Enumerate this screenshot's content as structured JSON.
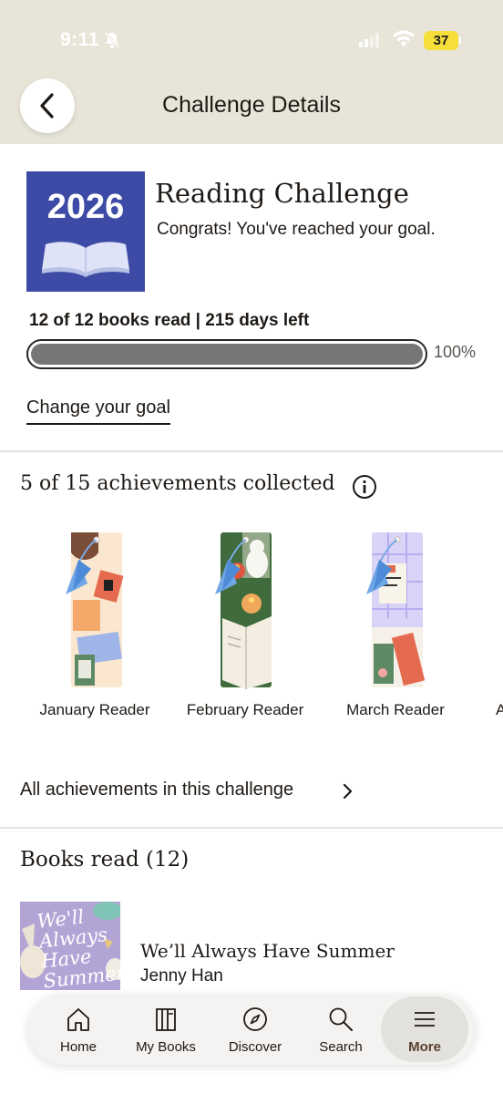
{
  "status_bar": {
    "time": "9:11",
    "battery": "37"
  },
  "header": {
    "title": "Challenge Details"
  },
  "challenge": {
    "badge_year": "2026",
    "title": "Reading Challenge",
    "message": "Congrats! You've reached your goal.",
    "progress_text": "12 of 12 books read | 215 days left",
    "progress_percent_label": "100%",
    "progress_fraction": 1.0,
    "change_goal_label": "Change your goal"
  },
  "achievements": {
    "title": "5 of 15 achievements collected",
    "items": [
      {
        "label": "January Reader"
      },
      {
        "label": "February Reader"
      },
      {
        "label": "March Reader"
      }
    ],
    "clipped_label": "A",
    "all_link": "All achievements in this challenge"
  },
  "books_read": {
    "title": "Books read (12)",
    "books": [
      {
        "title": "We’ll Always Have Summer",
        "author": "Jenny Han",
        "cover_text": "We'll Always Have Summer"
      }
    ]
  },
  "tabbar": {
    "tabs": [
      {
        "label": "Home",
        "icon": "home-icon"
      },
      {
        "label": "My Books",
        "icon": "books-icon"
      },
      {
        "label": "Discover",
        "icon": "compass-icon"
      },
      {
        "label": "Search",
        "icon": "search-icon"
      },
      {
        "label": "More",
        "icon": "menu-icon",
        "active": true
      }
    ]
  },
  "colors": {
    "header_bg": "#e8e5d8",
    "badge_bg": "#3e4ba6",
    "progress_fill": "#767676",
    "active_tab_text": "#5a3f2b"
  }
}
